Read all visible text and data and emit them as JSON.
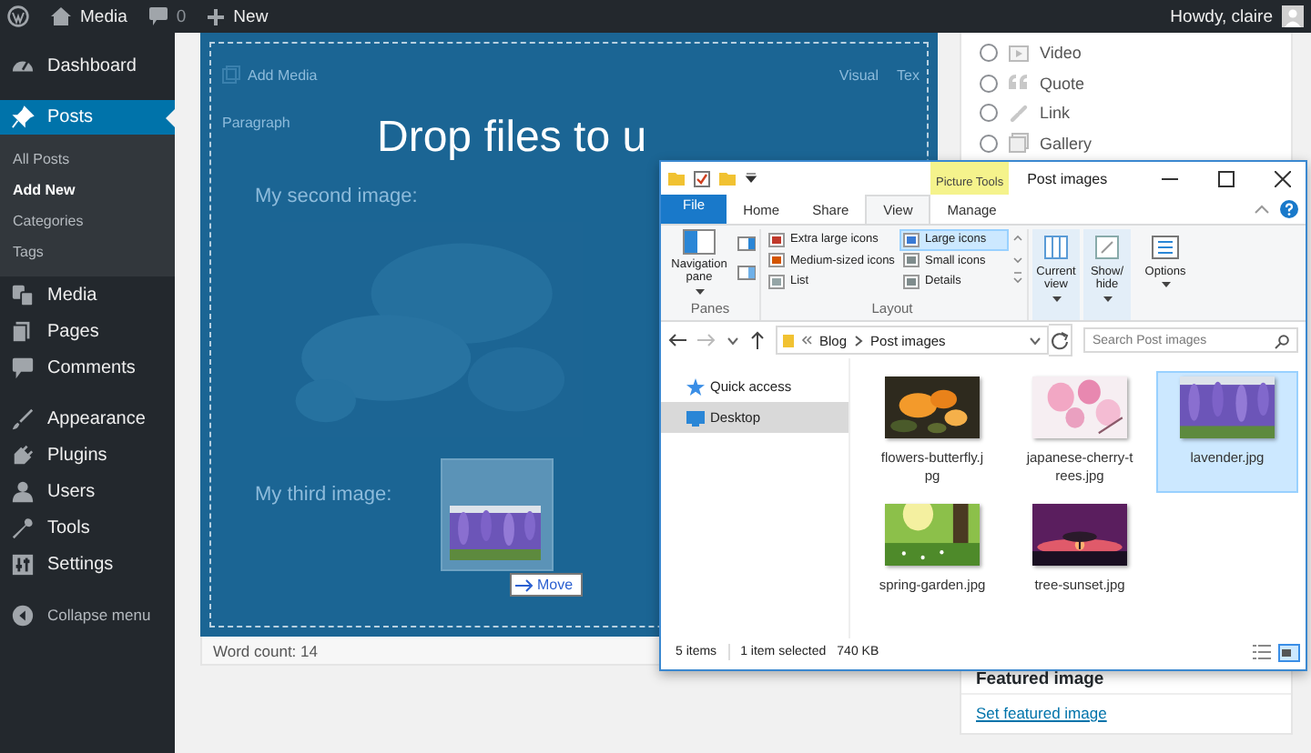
{
  "admin_bar": {
    "site": "Media",
    "comments": "0",
    "new": "New",
    "greeting": "Howdy, claire"
  },
  "menu_sections": [
    [
      {
        "label": "Dashboard",
        "selected": false
      }
    ],
    [
      {
        "label": "Posts",
        "selected": true,
        "children": [
          {
            "label": "All Posts",
            "selected": false
          },
          {
            "label": "Add New",
            "selected": true
          },
          {
            "label": "Categories",
            "selected": false
          },
          {
            "label": "Tags",
            "selected": false
          }
        ]
      },
      {
        "label": "Media",
        "selected": false
      },
      {
        "label": "Pages",
        "selected": false
      },
      {
        "label": "Comments",
        "selected": false
      }
    ],
    [
      {
        "label": "Appearance",
        "selected": false
      },
      {
        "label": "Plugins",
        "selected": false
      },
      {
        "label": "Users",
        "selected": false
      },
      {
        "label": "Tools",
        "selected": false
      },
      {
        "label": "Settings",
        "selected": false
      }
    ],
    [
      {
        "label": "Collapse menu",
        "selected": false
      }
    ]
  ],
  "editor": {
    "add_media": "Add Media",
    "modes": [
      "Visual",
      "Tex"
    ],
    "format": "Paragraph",
    "body": [
      {
        "kind": "text",
        "text": "My second image:"
      },
      {
        "kind": "picture"
      },
      {
        "kind": "text",
        "text": "My third image:"
      }
    ],
    "drop_message": "Drop files to u",
    "word_count": "Word count: 14"
  },
  "drag": {
    "action": "Move"
  },
  "post_formats": [
    {
      "label": "Video",
      "selected": false
    },
    {
      "label": "Quote",
      "selected": false
    },
    {
      "label": "Link",
      "selected": false
    },
    {
      "label": "Gallery",
      "selected": false
    }
  ],
  "featured_image": {
    "title": "Featured image",
    "link": "Set featured image"
  },
  "explorer": {
    "title": "Post images",
    "context_tab": "Picture Tools",
    "tabs": [
      {
        "label": "File",
        "kind": "file",
        "selected": false
      },
      {
        "label": "Home",
        "kind": "tab",
        "selected": false
      },
      {
        "label": "Share",
        "kind": "tab",
        "selected": false
      },
      {
        "label": "View",
        "kind": "tab",
        "selected": true
      },
      {
        "label": "Manage",
        "kind": "tab",
        "selected": false
      }
    ],
    "panes": {
      "button": "Navigation pane",
      "label": "Panes"
    },
    "layout": {
      "label": "Layout",
      "options": [
        {
          "label": "Extra large icons",
          "selected": false
        },
        {
          "label": "Large icons",
          "selected": true
        },
        {
          "label": "Medium-sized icons",
          "selected": false
        },
        {
          "label": "Small icons",
          "selected": false
        },
        {
          "label": "List",
          "selected": false
        },
        {
          "label": "Details",
          "selected": false
        }
      ]
    },
    "view_buttons": [
      "Current view",
      "Show/ hide",
      "Options"
    ],
    "path": [
      "Blog",
      "Post images"
    ],
    "search_placeholder": "Search Post images",
    "nav": [
      {
        "label": "Quick access",
        "selected": false
      },
      {
        "label": "Desktop",
        "selected": true
      }
    ],
    "files": [
      {
        "name": "flowers-butterfly.jpg",
        "selected": false
      },
      {
        "name": "japanese-cherry-trees.jpg",
        "selected": false
      },
      {
        "name": "lavender.jpg",
        "selected": true
      },
      {
        "name": "spring-garden.jpg",
        "selected": false
      },
      {
        "name": "tree-sunset.jpg",
        "selected": false
      }
    ],
    "status": {
      "count": "5 items",
      "selection": "1 item selected",
      "size": "740 KB"
    }
  }
}
